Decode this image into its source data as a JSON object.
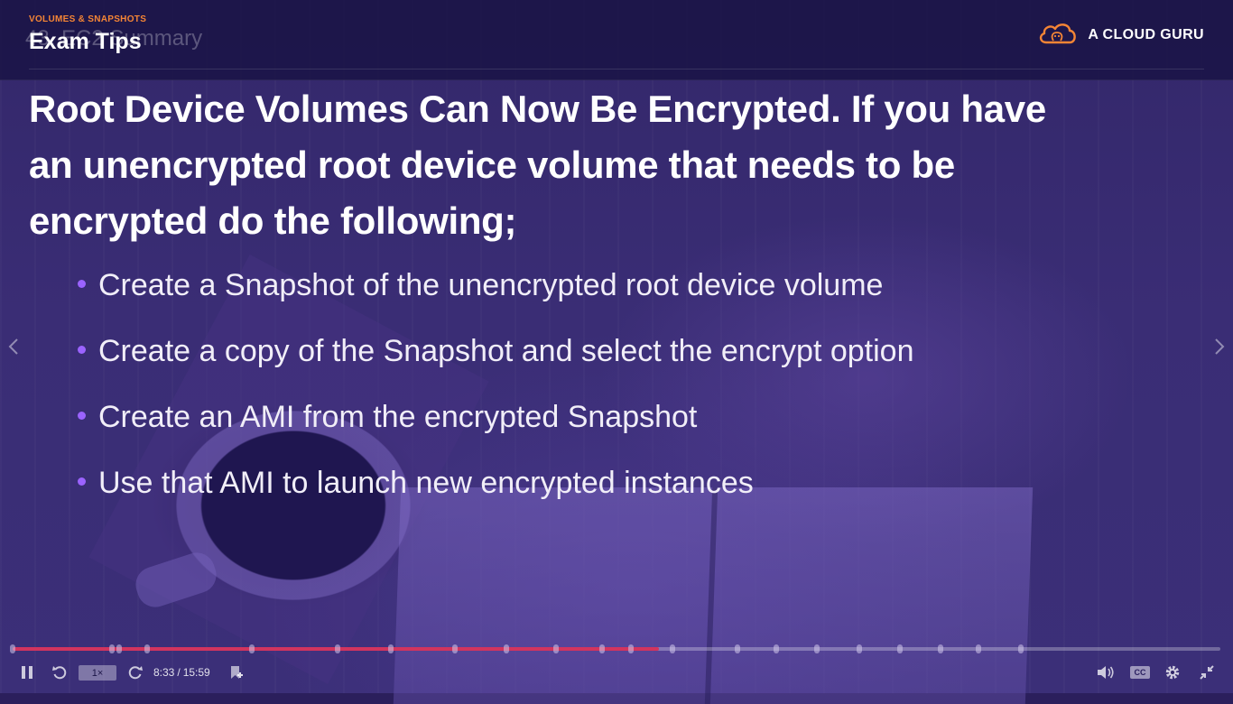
{
  "header": {
    "kicker": "VOLUMES & SNAPSHOTS",
    "ghost_title": "43. EC2 Summary",
    "title": "Exam Tips",
    "brand_name": "A CLOUD GURU",
    "brand_color": "#f58535"
  },
  "slide": {
    "heading": "Root Device Volumes Can Now Be Encrypted. If you have an unencrypted root device volume that needs to be encrypted do the following;",
    "bullets": [
      "Create a Snapshot of the unencrypted root device volume",
      "Create a copy of the Snapshot and select the encrypt option",
      "Create an AMI from the encrypted Snapshot",
      "Use that AMI to launch new encrypted instances"
    ],
    "bullet_color": "#9b63ff"
  },
  "nav": {
    "prev_icon": "chevron-left-icon",
    "next_icon": "chevron-right-icon"
  },
  "player": {
    "played_fraction": 0.535,
    "progress_color": "#d2345e",
    "chapter_marks_fraction": [
      0.0,
      0.082,
      0.088,
      0.111,
      0.198,
      0.269,
      0.313,
      0.366,
      0.409,
      0.45,
      0.488,
      0.512,
      0.546,
      0.6,
      0.632,
      0.666,
      0.701,
      0.735,
      0.768,
      0.8,
      0.835
    ],
    "speed": "1×",
    "current_time": "8:33",
    "time_separator": "/",
    "duration": "15:59",
    "cc_label": "CC",
    "icons": [
      "pause-icon",
      "rewind-icon",
      "forward-icon",
      "bookmark-icon",
      "volume-icon",
      "settings-icon",
      "fullscreen-exit-icon"
    ]
  }
}
